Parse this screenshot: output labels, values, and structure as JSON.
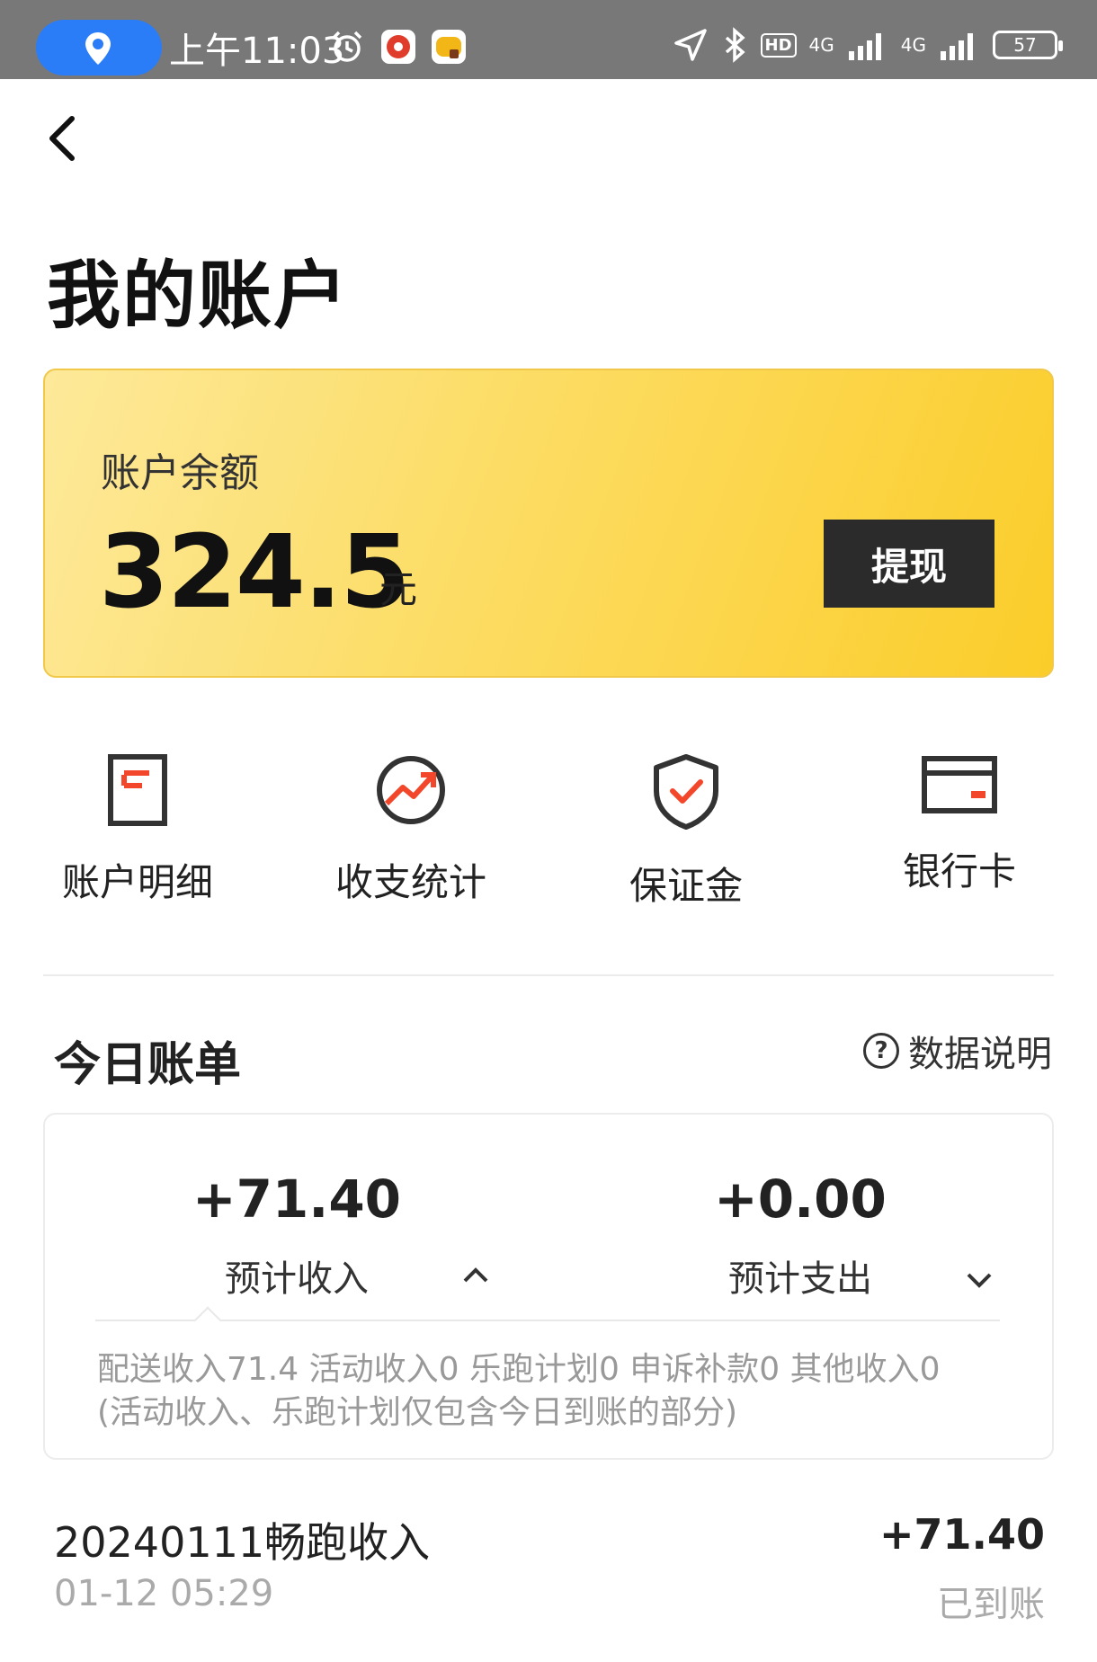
{
  "status_bar": {
    "time": "上午11:03",
    "network_1": "4G",
    "network_2": "4G",
    "hd_label": "HD",
    "battery": "57"
  },
  "header": {
    "title": "我的账户"
  },
  "balance": {
    "label": "账户余额",
    "value": "324.5",
    "unit": "元",
    "withdraw_label": "提现"
  },
  "shortcuts": [
    {
      "label": "账户明细",
      "icon": "document-icon"
    },
    {
      "label": "收支统计",
      "icon": "trend-icon"
    },
    {
      "label": "保证金",
      "icon": "shield-check-icon"
    },
    {
      "label": "银行卡",
      "icon": "bank-card-icon"
    }
  ],
  "today_bill": {
    "title": "今日账单",
    "help_label": "数据说明",
    "income_value": "+71.40",
    "income_label": "预计收入",
    "expense_value": "+0.00",
    "expense_label": "预计支出",
    "detail_line1": "配送收入71.4 活动收入0 乐跑计划0 申诉补款0 其他收入0",
    "detail_line2": "(活动收入、乐跑计划仅包含今日到账的部分)"
  },
  "transactions": [
    {
      "title": "20240111畅跑收入",
      "time": "01-12 05:29",
      "amount": "+71.40",
      "status": "已到账"
    }
  ],
  "colors": {
    "accent": "#fbcd2a",
    "accent_light": "#fde99a",
    "icon_red": "#f2472a",
    "dark": "#2b2b2b",
    "status_bar": "#787878",
    "location_pill": "#2a7df7"
  }
}
